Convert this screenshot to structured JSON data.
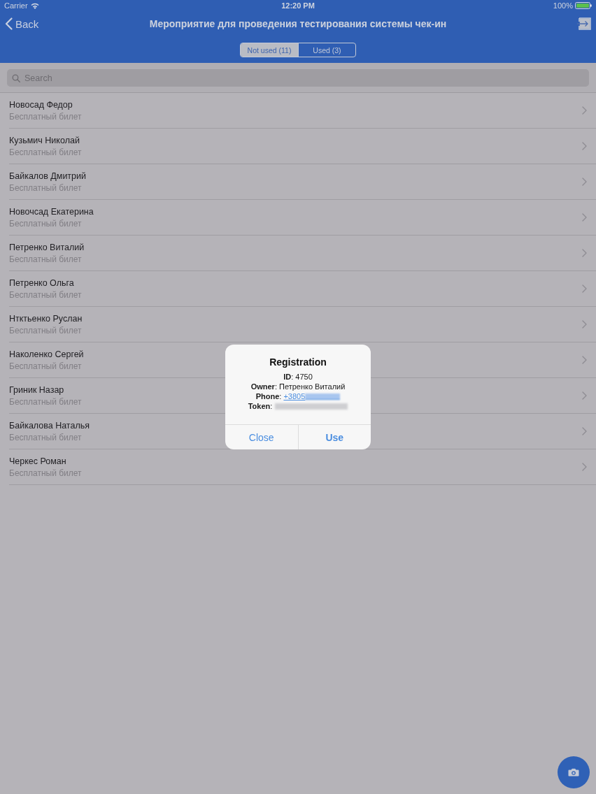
{
  "status_bar": {
    "carrier": "Carrier",
    "time": "12:20 PM",
    "battery": "100%"
  },
  "nav_bar": {
    "back": "Back",
    "title": "Мероприятие для проведения тестирования системы чек-ин"
  },
  "segments": [
    {
      "label": "Not used (11)",
      "selected": true
    },
    {
      "label": "Used (3)",
      "selected": false
    }
  ],
  "search": {
    "placeholder": "Search"
  },
  "attendees": [
    {
      "name": "Новосад Федор",
      "ticket": "Бесплатный билет"
    },
    {
      "name": "Кузьмич Николай",
      "ticket": "Бесплатный билет"
    },
    {
      "name": "Байкалов Дмитрий",
      "ticket": "Бесплатный билет"
    },
    {
      "name": "Новочсад Екатерина",
      "ticket": "Бесплатный билет"
    },
    {
      "name": "Петренко Виталий",
      "ticket": "Бесплатный билет"
    },
    {
      "name": "Петренко Ольга",
      "ticket": "Бесплатный билет"
    },
    {
      "name": "Нтктьенко Руслан",
      "ticket": "Бесплатный билет"
    },
    {
      "name": "Наколенко Сергей",
      "ticket": "Бесплатный билет"
    },
    {
      "name": "Гриник Назар",
      "ticket": "Бесплатный билет"
    },
    {
      "name": "Байкалова Наталья",
      "ticket": "Бесплатный билет"
    },
    {
      "name": "Черкес Роман",
      "ticket": "Бесплатный билет"
    }
  ],
  "dialog": {
    "title": "Registration",
    "fields": [
      {
        "kind": "plain",
        "text": "**ID**: 4750"
      },
      {
        "kind": "plain",
        "text": "**Owner**: Петренко Виталий"
      },
      {
        "kind": "link",
        "text": "**Phone**:",
        "link": "+3805"
      },
      {
        "kind": "redacted",
        "text": "**Token**:"
      }
    ],
    "buttons": [
      {
        "label": "Close",
        "kind": "cancel"
      },
      {
        "label": "Use",
        "kind": "default"
      }
    ]
  }
}
